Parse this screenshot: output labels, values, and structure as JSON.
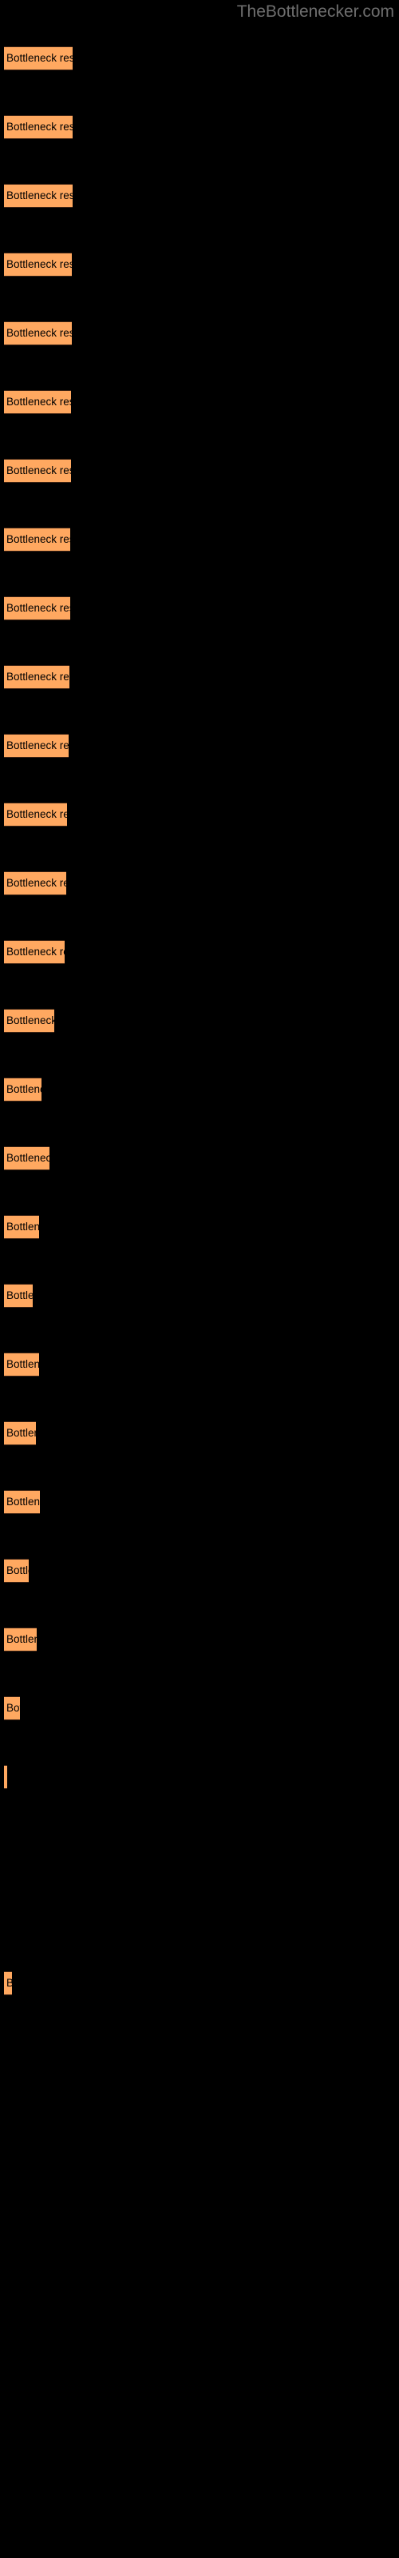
{
  "site": {
    "title": "TheBottlenecker.com",
    "title_color": "#6e6e6e"
  },
  "colors": {
    "background": "#000000",
    "bar_fill": "#ffa860",
    "bar_border": "#3a2112",
    "bar_label_text": "#000000"
  },
  "chart_data": {
    "type": "bar",
    "orientation": "horizontal",
    "title": "",
    "subtitle": "",
    "xlabel": "",
    "ylabel": "",
    "grid": false,
    "legend": null,
    "bar_label_text": "Bottleneck result",
    "axis_visible": false,
    "tick_labels": [],
    "xlim": [
      0,
      100
    ],
    "categories": [
      "bar-1",
      "bar-2",
      "bar-3",
      "bar-4",
      "bar-5",
      "bar-6",
      "bar-7",
      "bar-8",
      "bar-9",
      "bar-10",
      "bar-11",
      "bar-12",
      "bar-13",
      "bar-14",
      "bar-15",
      "bar-16",
      "bar-17",
      "bar-18",
      "bar-19",
      "bar-20",
      "bar-21",
      "bar-22",
      "bar-23",
      "bar-24",
      "bar-25",
      "bar-26",
      "bar-27"
    ],
    "values": [
      86,
      86,
      86,
      85,
      85,
      84,
      84,
      83,
      83,
      82,
      81,
      79,
      78,
      76,
      63,
      47,
      57,
      44,
      36,
      44,
      40,
      45,
      31,
      41,
      20,
      4,
      4
    ],
    "bars": [
      {
        "name": "bar-1",
        "label": "Bottleneck result",
        "y": 58,
        "width": 86,
        "height": 30
      },
      {
        "name": "bar-2",
        "label": "Bottleneck result",
        "y": 144,
        "width": 86,
        "height": 30
      },
      {
        "name": "bar-3",
        "label": "Bottleneck result",
        "y": 230,
        "width": 86,
        "height": 30
      },
      {
        "name": "bar-4",
        "label": "Bottleneck result",
        "y": 316,
        "width": 85,
        "height": 30
      },
      {
        "name": "bar-5",
        "label": "Bottleneck result",
        "y": 402,
        "width": 85,
        "height": 30
      },
      {
        "name": "bar-6",
        "label": "Bottleneck result",
        "y": 488,
        "width": 84,
        "height": 30
      },
      {
        "name": "bar-7",
        "label": "Bottleneck result",
        "y": 574,
        "width": 84,
        "height": 30
      },
      {
        "name": "bar-8",
        "label": "Bottleneck result",
        "y": 660,
        "width": 83,
        "height": 30
      },
      {
        "name": "bar-9",
        "label": "Bottleneck result",
        "y": 746,
        "width": 83,
        "height": 30
      },
      {
        "name": "bar-10",
        "label": "Bottleneck result",
        "y": 832,
        "width": 82,
        "height": 30
      },
      {
        "name": "bar-11",
        "label": "Bottleneck result",
        "y": 918,
        "width": 81,
        "height": 30
      },
      {
        "name": "bar-12",
        "label": "Bottleneck result",
        "y": 1004,
        "width": 79,
        "height": 30
      },
      {
        "name": "bar-13",
        "label": "Bottleneck result",
        "y": 1090,
        "width": 78,
        "height": 30
      },
      {
        "name": "bar-14",
        "label": "Bottleneck result",
        "y": 1176,
        "width": 76,
        "height": 30
      },
      {
        "name": "bar-15",
        "label": "Bottleneck result",
        "y": 1262,
        "width": 63,
        "height": 30
      },
      {
        "name": "bar-16",
        "label": "Bottleneck result",
        "y": 1348,
        "width": 47,
        "height": 30
      },
      {
        "name": "bar-17",
        "label": "Bottleneck result",
        "y": 1434,
        "width": 57,
        "height": 30
      },
      {
        "name": "bar-18",
        "label": "Bottleneck result",
        "y": 1520,
        "width": 44,
        "height": 30
      },
      {
        "name": "bar-19",
        "label": "Bottleneck result",
        "y": 1606,
        "width": 36,
        "height": 30
      },
      {
        "name": "bar-20",
        "label": "Bottleneck result",
        "y": 1692,
        "width": 44,
        "height": 30
      },
      {
        "name": "bar-21",
        "label": "Bottleneck result",
        "y": 1778,
        "width": 40,
        "height": 30
      },
      {
        "name": "bar-22",
        "label": "Bottleneck result",
        "y": 1864,
        "width": 45,
        "height": 30
      },
      {
        "name": "bar-23",
        "label": "Bottleneck result",
        "y": 1950,
        "width": 31,
        "height": 30
      },
      {
        "name": "bar-24",
        "label": "Bottleneck result",
        "y": 2036,
        "width": 41,
        "height": 30
      },
      {
        "name": "bar-25",
        "label": "Bottleneck result",
        "y": 2122,
        "width": 20,
        "height": 30
      },
      {
        "name": "bar-26",
        "label": "Bottleneck result",
        "y": 2208,
        "width": 4,
        "height": 30
      },
      {
        "name": "bar-27",
        "label": "Bottleneck result",
        "y": 2466,
        "width": 10,
        "height": 30
      }
    ]
  }
}
